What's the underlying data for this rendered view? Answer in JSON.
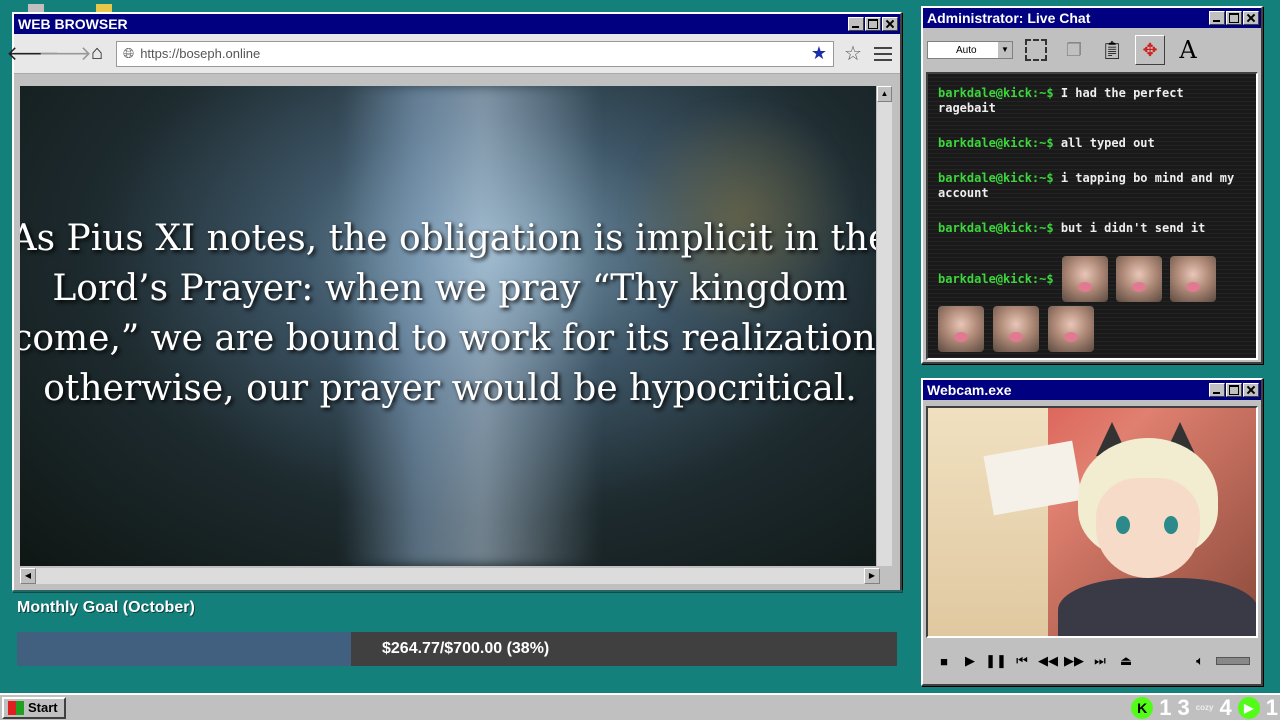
{
  "browser": {
    "title": "WEB BROWSER",
    "url": "https://boseph.online",
    "caption": "As Pius XI notes, the obligation is implicit in the\nLord’s Prayer: when we pray “Thy kingdom\ncome,” we are bound to work for its realization;\notherwise, our prayer would be hypocritical."
  },
  "goal": {
    "label": "Monthly Goal (October)",
    "amount_text": "$264.77/$700.00 (38%)",
    "progress": 0.38
  },
  "chat": {
    "title": "Administrator: Live Chat",
    "font_select": "Auto",
    "font_button": "A",
    "prompt": "barkdale@kick:~$",
    "messages": [
      {
        "text": "I had the perfect ragebait"
      },
      {
        "text": "all typed out"
      },
      {
        "text": "i tapping bo mind and my account"
      },
      {
        "text": "but i didn't send it"
      }
    ]
  },
  "webcam": {
    "title": "Webcam.exe"
  },
  "taskbar": {
    "start": "Start",
    "tray_num1": "1",
    "tray_num2": "3",
    "tray_cozy": "cozy",
    "tray_num3": "4",
    "tray_num4": "1"
  },
  "colors": {
    "desktop": "#14807c",
    "titlebar": "#000080",
    "prompt": "#3cd63c",
    "goal_fill": "#41607f",
    "kick_green": "#53fc18"
  }
}
